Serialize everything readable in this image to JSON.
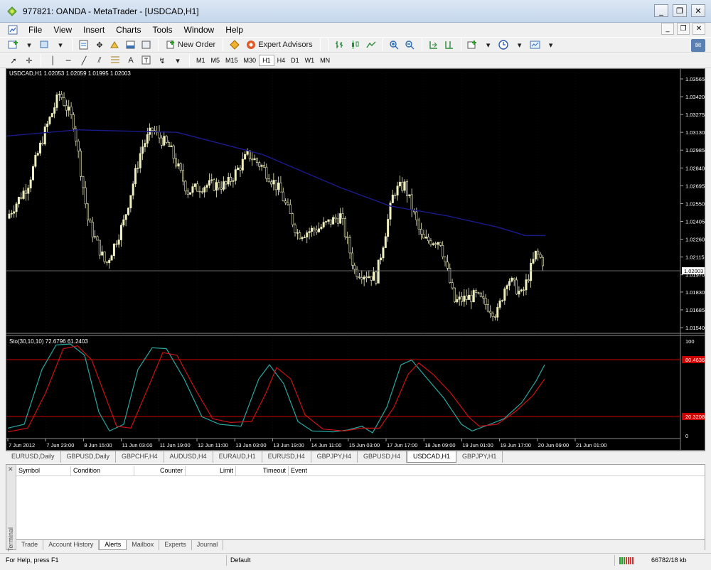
{
  "window": {
    "title": "977821: OANDA - MetaTrader - [USDCAD,H1]",
    "minimize": "_",
    "restore": "❐",
    "close": "✕"
  },
  "menu": [
    "File",
    "View",
    "Insert",
    "Charts",
    "Tools",
    "Window",
    "Help"
  ],
  "toolbar": {
    "new_order": "New Order",
    "expert_advisors": "Expert Advisors",
    "timeframes": [
      "M1",
      "M5",
      "M15",
      "M30",
      "H1",
      "H4",
      "D1",
      "W1",
      "MN"
    ],
    "active_timeframe": "H1",
    "text_tool": "A"
  },
  "chart": {
    "header": "USDCAD,H1  1.02053 1.02059 1.01995 1.02003",
    "indicator_header": "Sto(30,10,10) 72.6796 61.2403",
    "current_price": "1.02003",
    "price_ticks": [
      "1.03565",
      "1.03420",
      "1.03275",
      "1.03130",
      "1.02985",
      "1.02840",
      "1.02695",
      "1.02550",
      "1.02405",
      "1.02260",
      "1.02115",
      "1.01970",
      "1.01830",
      "1.01685",
      "1.01540"
    ],
    "stoch_ticks": [
      "100",
      "80.4636",
      "20.3208",
      "0"
    ],
    "time_ticks": [
      "7 Jun 2012",
      "7 Jun 23:00",
      "8 Jun 15:00",
      "11 Jun 03:00",
      "11 Jun 19:00",
      "12 Jun 11:00",
      "13 Jun 03:00",
      "13 Jun 19:00",
      "14 Jun 11:00",
      "15 Jun 03:00",
      "17 Jun 17:00",
      "18 Jun 09:00",
      "19 Jun 01:00",
      "19 Jun 17:00",
      "20 Jun 09:00",
      "21 Jun 01:00"
    ],
    "colors": {
      "background": "#000000",
      "candle": "#f0efc0",
      "moving_average": "#1a1a8c",
      "stoch_main": "#2aa7a0",
      "stoch_signal": "#cc1111",
      "level_line": "#cc0000",
      "grid": "#333333"
    }
  },
  "chart_tabs": [
    "EURUSD,Daily",
    "GBPUSD,Daily",
    "GBPCHF,H4",
    "AUDUSD,H4",
    "EURAUD,H1",
    "EURUSD,H4",
    "GBPJPY,H4",
    "GBPUSD,H4",
    "USDCAD,H1",
    "GBPJPY,H1"
  ],
  "active_chart_tab": "USDCAD,H1",
  "terminal": {
    "label": "Terminal",
    "columns": [
      "Symbol",
      "Condition",
      "Counter",
      "Limit",
      "Timeout",
      "Event"
    ],
    "tabs": [
      "Trade",
      "Account History",
      "Alerts",
      "Mailbox",
      "Experts",
      "Journal"
    ],
    "active_tab": "Alerts"
  },
  "status": {
    "help": "For Help, press F1",
    "profile": "Default",
    "traffic": "66782/18 kb"
  }
}
